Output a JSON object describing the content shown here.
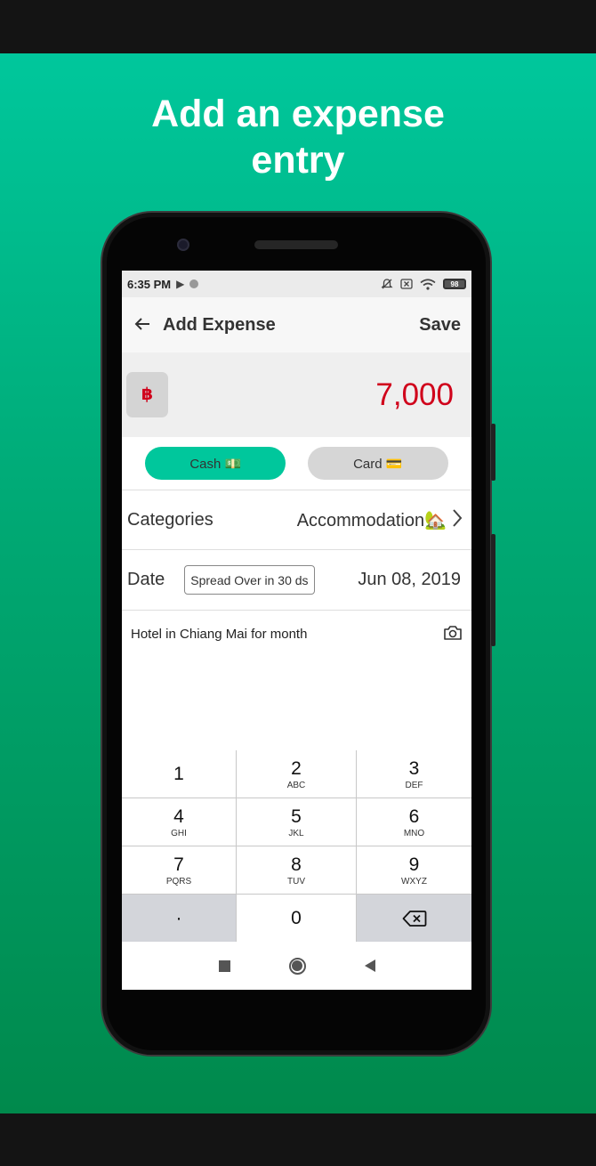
{
  "promo": {
    "headline_line1": "Add an expense",
    "headline_line2": "entry"
  },
  "status_bar": {
    "time": "6:35 PM",
    "battery": "98"
  },
  "app_bar": {
    "title": "Add Expense",
    "save_label": "Save"
  },
  "amount": {
    "currency_symbol": "฿",
    "value": "7,000"
  },
  "payment_methods": [
    {
      "label": "Cash 💵",
      "selected": true
    },
    {
      "label": "Card 💳",
      "selected": false
    }
  ],
  "category": {
    "label": "Categories",
    "value": "Accommodation🏡"
  },
  "date": {
    "label": "Date",
    "spread_label": "Spread Over in 30 ds",
    "value": "Jun 08, 2019"
  },
  "note": {
    "text": "Hotel in Chiang Mai for month"
  },
  "keypad": [
    {
      "num": "1",
      "sub": ""
    },
    {
      "num": "2",
      "sub": "ABC"
    },
    {
      "num": "3",
      "sub": "DEF"
    },
    {
      "num": "4",
      "sub": "GHI"
    },
    {
      "num": "5",
      "sub": "JKL"
    },
    {
      "num": "6",
      "sub": "MNO"
    },
    {
      "num": "7",
      "sub": "PQRS"
    },
    {
      "num": "8",
      "sub": "TUV"
    },
    {
      "num": "9",
      "sub": "WXYZ"
    },
    {
      "num": "·",
      "sub": ""
    },
    {
      "num": "0",
      "sub": ""
    }
  ],
  "colors": {
    "accent": "#00c79c",
    "amount": "#d0021b",
    "promo_top": "#00c79c",
    "promo_bottom": "#00894c"
  }
}
